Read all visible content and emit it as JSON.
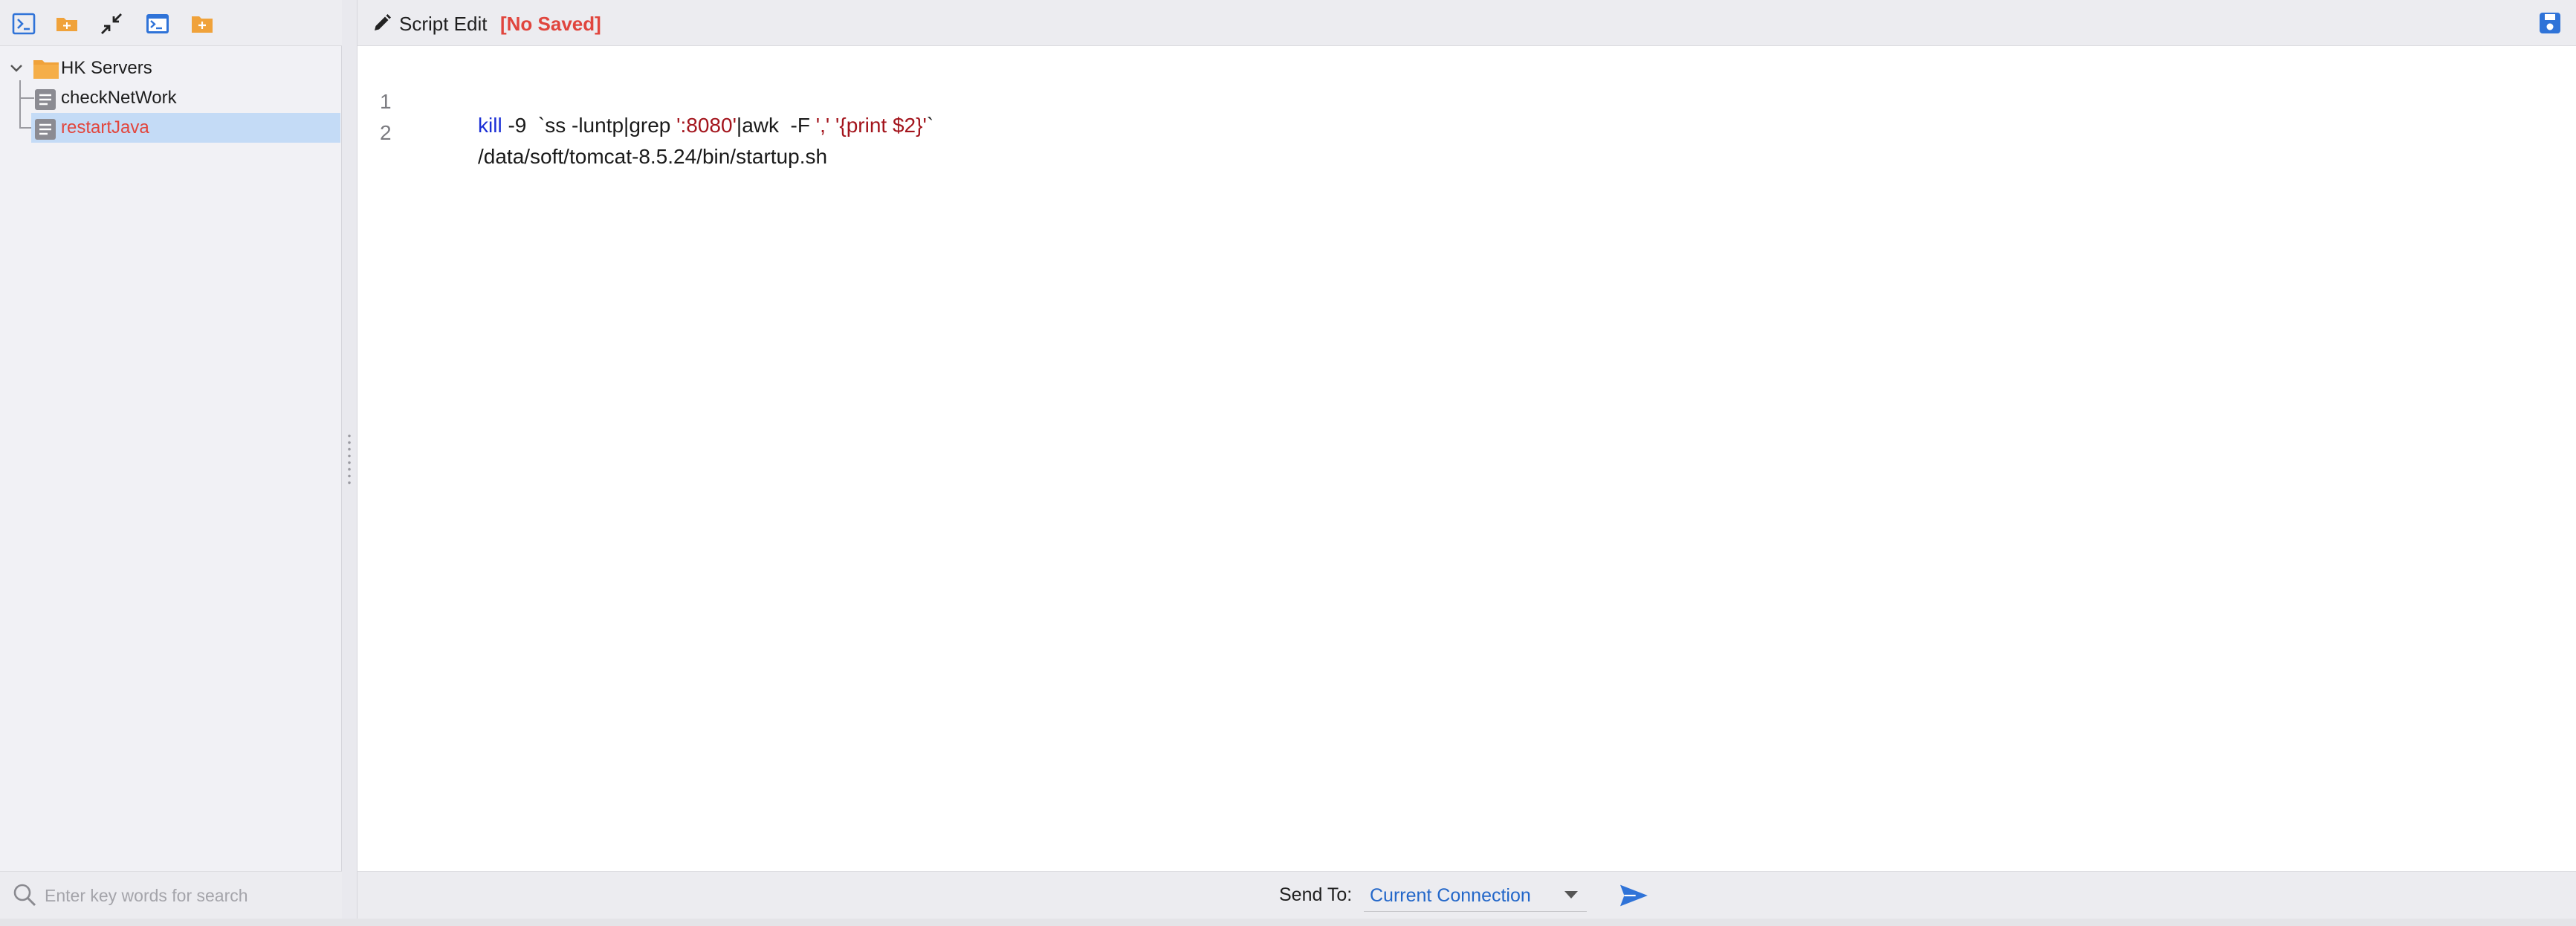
{
  "toolbar": {
    "buttons": [
      {
        "icon": "terminal-icon"
      },
      {
        "icon": "new-folder-icon"
      },
      {
        "icon": "collapse-icon"
      },
      {
        "icon": "terminal-window-icon"
      },
      {
        "icon": "add-folder-icon"
      }
    ]
  },
  "tree": {
    "folder": {
      "label": "HK Servers",
      "expanded": true
    },
    "items": [
      {
        "label": "checkNetWork",
        "selected": false
      },
      {
        "label": "restartJava",
        "selected": true
      }
    ]
  },
  "search": {
    "placeholder": "Enter key words for search",
    "value": ""
  },
  "editor": {
    "title": "Script Edit",
    "status": "[No Saved]",
    "lines": [
      {
        "num": "1",
        "parts": [
          {
            "t": "kill",
            "c": "kw"
          },
          {
            "t": " -9  `ss -luntp|grep ",
            "c": ""
          },
          {
            "t": "':8080'",
            "c": "str"
          },
          {
            "t": "|awk  -F ",
            "c": ""
          },
          {
            "t": "','",
            "c": "str"
          },
          {
            "t": " ",
            "c": ""
          },
          {
            "t": "'{print $2}'",
            "c": "str"
          },
          {
            "t": "`",
            "c": ""
          }
        ]
      },
      {
        "num": "2",
        "parts": [
          {
            "t": "/data/soft/tomcat-8.5.24/bin/startup.sh",
            "c": ""
          }
        ]
      }
    ]
  },
  "send": {
    "label": "Send To:",
    "target": "Current Connection"
  },
  "colors": {
    "accent": "#2367c9",
    "folder": "#f0a23a",
    "unsaved": "#e0453d",
    "selection": "#c4dbf6",
    "keyword": "#1b2fd6",
    "string": "#a3141c"
  }
}
